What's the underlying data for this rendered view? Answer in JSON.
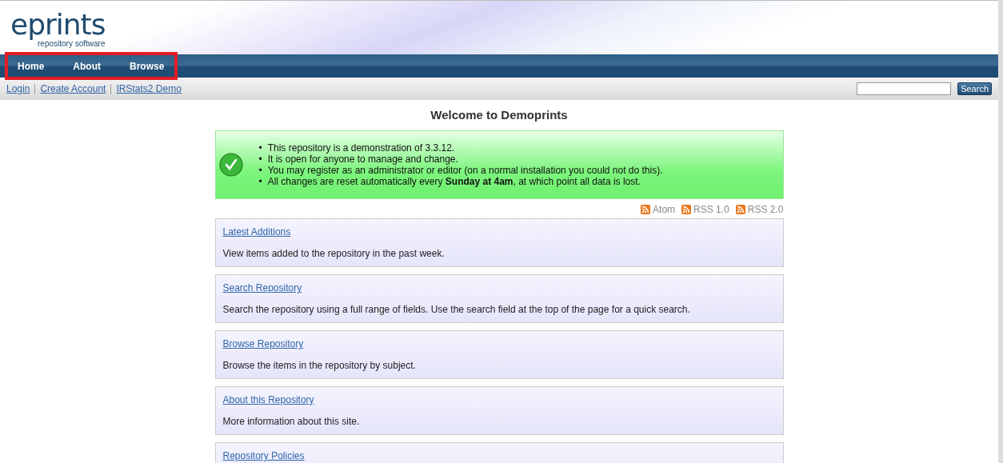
{
  "logo": {
    "word": "eprints",
    "tagline": "repository software"
  },
  "nav": {
    "highlighted": true,
    "items": [
      {
        "label": "Home"
      },
      {
        "label": "About"
      },
      {
        "label": "Browse"
      }
    ]
  },
  "user_links": [
    {
      "label": "Login"
    },
    {
      "label": "Create Account"
    },
    {
      "label": "IRStats2 Demo"
    }
  ],
  "search": {
    "button": "Search"
  },
  "title": "Welcome to Demoprints",
  "notice": {
    "items": [
      {
        "marker": "•",
        "text": "This repository is a demonstration of 3.3.12."
      },
      {
        "marker": "•",
        "text": "It is open for anyone to manage and change."
      },
      {
        "marker": "•",
        "text": "You may register as an administrator or editor (on a normal installation you could not do this)."
      },
      {
        "marker": "•",
        "text": "All changes are reset automatically every **Sunday at 4am**, at which point all data is lost."
      }
    ]
  },
  "feeds": [
    {
      "label": "Atom"
    },
    {
      "label": "RSS 1.0"
    },
    {
      "label": "RSS 2.0"
    }
  ],
  "cards": [
    {
      "title": "Latest Additions",
      "text": "View items added to the repository in the past week."
    },
    {
      "title": "Search Repository",
      "text": "Search the repository using a full range of fields. Use the search field at the top of the page for a quick search."
    },
    {
      "title": "Browse Repository",
      "text": "Browse the items in the repository by subject."
    },
    {
      "title": "About this Repository",
      "text": "More information about this site."
    },
    {
      "title": "Repository Policies"
    }
  ]
}
